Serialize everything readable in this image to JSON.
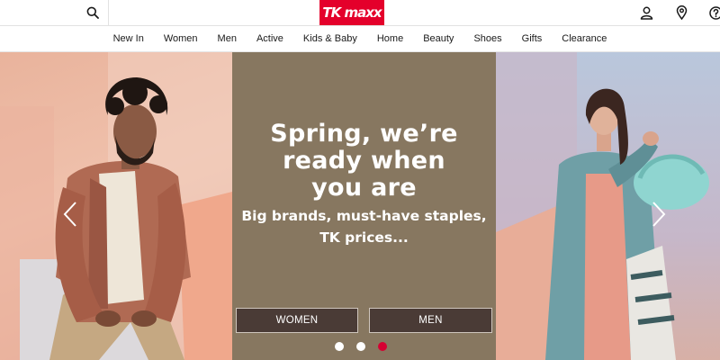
{
  "header": {
    "logo_text": "TK maxx",
    "icons": [
      "search-icon",
      "account-icon",
      "location-icon",
      "help-icon"
    ],
    "brand_color": "#e4002b"
  },
  "nav": {
    "items": [
      "New In",
      "Women",
      "Men",
      "Active",
      "Kids & Baby",
      "Home",
      "Beauty",
      "Shoes",
      "Gifts",
      "Clearance"
    ]
  },
  "hero": {
    "headline_lines": [
      "Spring, we’re",
      "ready when",
      "you are"
    ],
    "sub_lines": [
      "Big brands, must-have staples,",
      "TK prices..."
    ],
    "cta_women": "WOMEN",
    "cta_men": "MEN",
    "slides": 3,
    "active_slide": 3,
    "center_color": "#877760",
    "cta_color": "#4a3b36",
    "dot_active_color": "#d50032"
  }
}
